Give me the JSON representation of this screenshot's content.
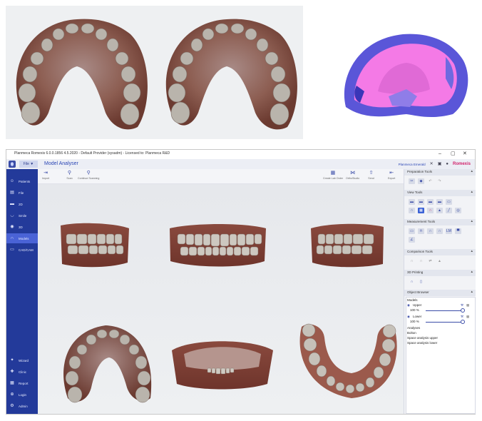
{
  "window": {
    "title": "Planmeca Romexis 6.0.0.1856 4.5.2020 - Default Provider (sysadm) - Licensed to: Planmeca R&D",
    "minimize": "–",
    "maximize": "▢",
    "close": "✕"
  },
  "menubar": {
    "file_label": "File ▼",
    "module_title": "Model Analyser",
    "provider": "Planmeca Emerald",
    "brand": "Romexis"
  },
  "sidebar": {
    "items": [
      {
        "label": "Patients",
        "icon": "people-icon"
      },
      {
        "label": "File",
        "icon": "file-icon"
      },
      {
        "label": "2D",
        "icon": "2d-icon"
      },
      {
        "label": "Smile",
        "icon": "smile-icon"
      },
      {
        "label": "3D",
        "icon": "3d-icon"
      },
      {
        "label": "Models",
        "icon": "models-icon"
      },
      {
        "label": "CAD/CAM",
        "icon": "cadcam-icon"
      }
    ],
    "bottom_items": [
      {
        "label": "Wizard",
        "icon": "wizard-icon"
      },
      {
        "label": "Clinic",
        "icon": "clinic-icon"
      },
      {
        "label": "Report",
        "icon": "report-icon"
      },
      {
        "label": "Login",
        "icon": "login-icon"
      },
      {
        "label": "Admin",
        "icon": "admin-icon"
      }
    ]
  },
  "toolbar": {
    "import": "Import",
    "scan": "Scan",
    "continue_scanning": "Continue Scanning",
    "create_lab_order": "Create Lab Order",
    "orthostudio": "OrthoStudio",
    "send": "Send",
    "export": "Export"
  },
  "right_panel": {
    "preparation_tools": "Preparation Tools",
    "view_tools": "View Tools",
    "measurement_tools": "Measurement Tools",
    "comparison_tools": "Comparison Tools",
    "printing_3d": "3D Printing",
    "object_browser": "Object Browser",
    "models_label": "Models",
    "upper": "Upper",
    "upper_opacity": "100 %",
    "lower": "Lower",
    "lower_opacity": "100 %",
    "analyses_label": "Analyses",
    "analyses": [
      "Bolton",
      "Space analysis upper",
      "Space analysis lower"
    ],
    "measure_lm": "LM"
  },
  "colors": {
    "sidebar": "#233a9a",
    "sidebar_active": "#4a63d6",
    "accent": "#2b46b5",
    "brand": "#d1236c"
  }
}
